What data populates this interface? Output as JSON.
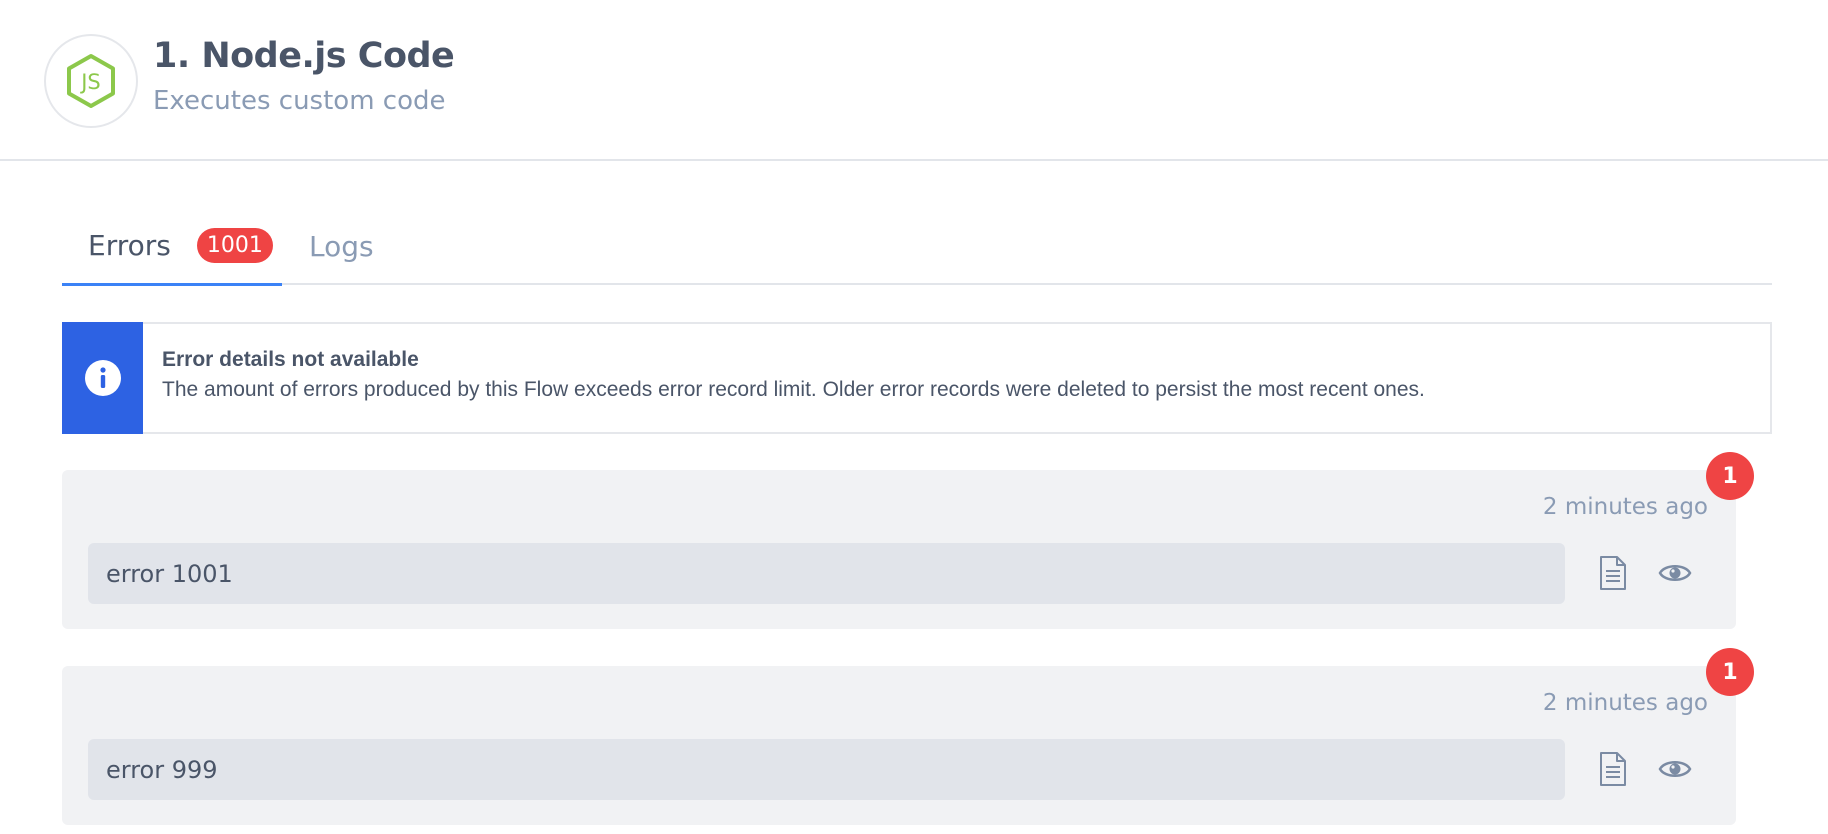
{
  "header": {
    "logo_icon": "nodejs-hexagon-icon",
    "logo_text": "JS",
    "title": "1. Node.js Code",
    "subtitle": "Executes custom code"
  },
  "tabs": [
    {
      "label": "Errors",
      "badge": "1001",
      "active": true
    },
    {
      "label": "Logs",
      "active": false
    }
  ],
  "alert": {
    "icon": "info-icon",
    "title": "Error details not available",
    "message": "The amount of errors produced by this Flow exceeds error record limit. Older error records were deleted to persist the most recent ones."
  },
  "errors": [
    {
      "count": "1",
      "timestamp": "2 minutes ago",
      "message": "error 1001",
      "actions": [
        "document-icon",
        "eye-icon"
      ]
    },
    {
      "count": "1",
      "timestamp": "2 minutes ago",
      "message": "error 999",
      "actions": [
        "document-icon",
        "eye-icon"
      ]
    }
  ],
  "colors": {
    "accent": "#3b82f6",
    "alert_side": "#2d62e3",
    "badge": "#ef4444",
    "node_green": "#8cc84b"
  }
}
